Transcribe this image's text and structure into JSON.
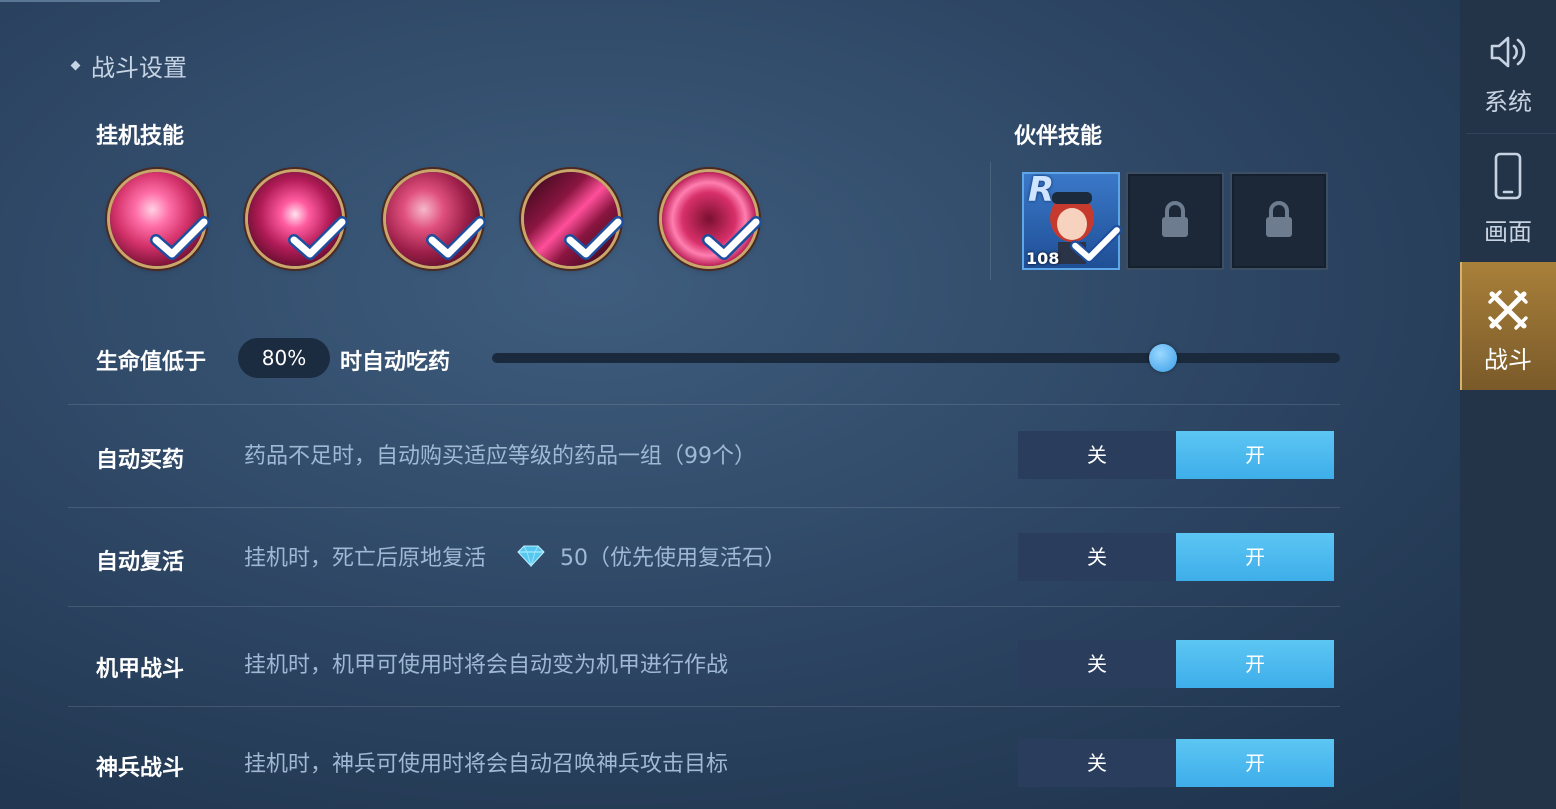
{
  "section_title": "战斗设置",
  "idle_skills": {
    "label": "挂机技能",
    "items": [
      {
        "name": "skill-1",
        "checked": true
      },
      {
        "name": "skill-2",
        "checked": true
      },
      {
        "name": "skill-3",
        "checked": true
      },
      {
        "name": "skill-4",
        "checked": true
      },
      {
        "name": "skill-5",
        "checked": true
      }
    ]
  },
  "partner_skills": {
    "label": "伙伴技能",
    "slots": [
      {
        "state": "filled",
        "rank": "R",
        "level": "108",
        "checked": true
      },
      {
        "state": "locked"
      },
      {
        "state": "locked"
      }
    ]
  },
  "hp_auto_potion": {
    "prefix": "生命值低于",
    "value": "80%",
    "suffix": "时自动吃药",
    "slider_fraction": 0.8
  },
  "toggles": [
    {
      "name": "自动买药",
      "desc": "药品不足时，自动购买适应等级的药品一组（99个）",
      "off_label": "关",
      "on_label": "开",
      "state": "on"
    },
    {
      "name": "自动复活",
      "desc_before": "挂机时，死亡后原地复活",
      "desc_after": "50（优先使用复活石）",
      "off_label": "关",
      "on_label": "开",
      "state": "on"
    },
    {
      "name": "机甲战斗",
      "desc": "挂机时，机甲可使用时将会自动变为机甲进行作战",
      "off_label": "关",
      "on_label": "开",
      "state": "on"
    },
    {
      "name": "神兵战斗",
      "desc": "挂机时，神兵可使用时将会自动召唤神兵攻击目标",
      "off_label": "关",
      "on_label": "开",
      "state": "on"
    }
  ],
  "sidebar": {
    "tabs": [
      {
        "label": "系统",
        "icon": "speaker-icon"
      },
      {
        "label": "画面",
        "icon": "phone-icon"
      },
      {
        "label": "战斗",
        "icon": "crossed-swords-icon",
        "active": true
      }
    ]
  },
  "colors": {
    "toggle_on": "#4db8ef",
    "toggle_off": "#2a3d5c",
    "active_tab": "#a9803a"
  }
}
